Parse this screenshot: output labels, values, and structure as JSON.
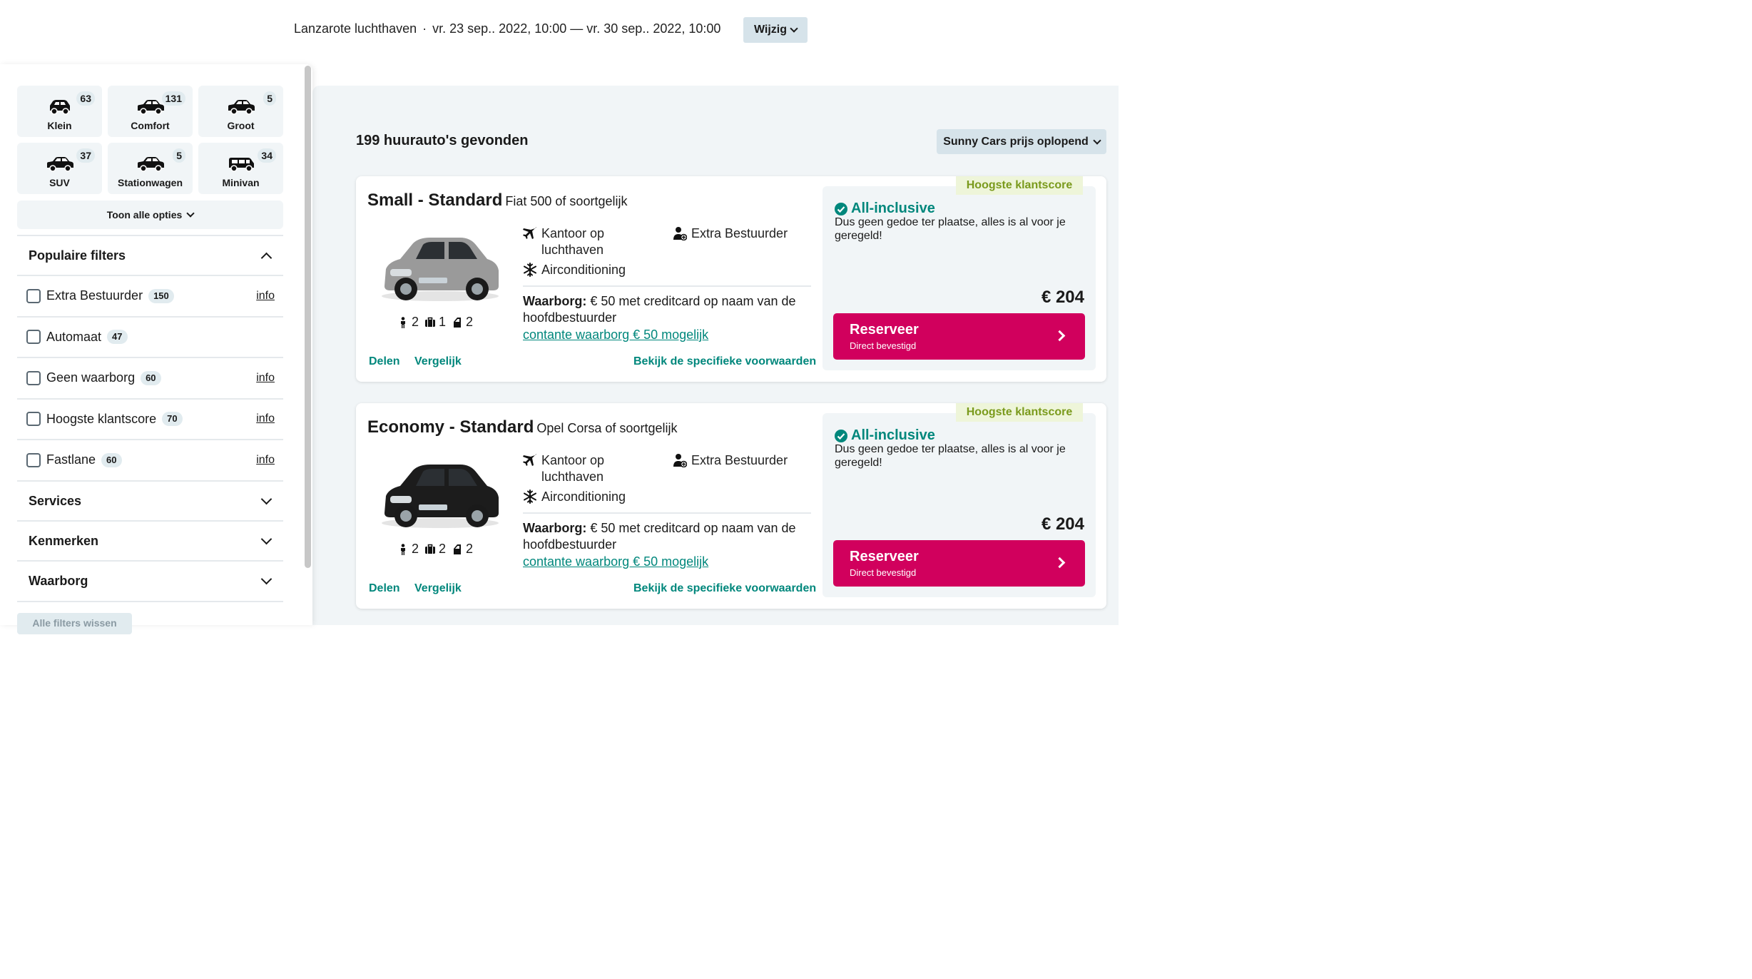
{
  "search": {
    "location": "Lanzarote luchthaven",
    "separator": "·",
    "dates": "vr. 23 sep.. 2022, 10:00 — vr. 30 sep.. 2022, 10:00",
    "change_label": "Wijzig"
  },
  "categories": [
    {
      "label": "Klein",
      "count": "63",
      "icon": "car-small-icon"
    },
    {
      "label": "Comfort",
      "count": "131",
      "icon": "car-comfort-icon"
    },
    {
      "label": "Groot",
      "count": "5",
      "icon": "car-large-icon"
    },
    {
      "label": "SUV",
      "count": "37",
      "icon": "suv-icon"
    },
    {
      "label": "Stationwagen",
      "count": "5",
      "icon": "station-wagon-icon"
    },
    {
      "label": "Minivan",
      "count": "34",
      "icon": "minivan-icon"
    }
  ],
  "show_all_label": "Toon alle opties",
  "popular_filters": {
    "title": "Populaire filters",
    "items": [
      {
        "label": "Extra Bestuurder",
        "count": "150",
        "info": "info"
      },
      {
        "label": "Automaat",
        "count": "47",
        "info": ""
      },
      {
        "label": "Geen waarborg",
        "count": "60",
        "info": "info"
      },
      {
        "label": "Hoogste klantscore",
        "count": "70",
        "info": "info"
      },
      {
        "label": "Fastlane",
        "count": "60",
        "info": "info"
      }
    ]
  },
  "sections": [
    "Services",
    "Kenmerken",
    "Waarborg"
  ],
  "clear_filters_label": "Alle filters wissen",
  "results": {
    "count_label": "199 huurauto's gevonden",
    "sort_label": "Sunny Cars prijs oplopend"
  },
  "cards": [
    {
      "category": "Small - Standard",
      "model": "Fiat 500 of soortgelijk",
      "car_color": "#9a9a9a",
      "passengers": "2",
      "suitcases": "1",
      "doors": "2",
      "feature_office": "Kantoor op luchthaven",
      "feature_ac": "Airconditioning",
      "feature_driver": "Extra Bestuurder",
      "deposit_label": "Waarborg:",
      "deposit_text": "€ 50 met creditcard op naam van de hoofdbestuurder",
      "deposit_link": "contante waarborg € 50 mogelijk",
      "share": "Delen",
      "compare": "Vergelijk",
      "terms": "Bekijk de specifieke voorwaarden",
      "badge": "Hoogste klantscore",
      "allinc_title": "All-inclusive",
      "allinc_desc": "Dus geen gedoe ter plaatse, alles is al voor je geregeld!",
      "price": "€ 204",
      "reserve_label": "Reserveer",
      "reserve_sub": "Direct bevestigd"
    },
    {
      "category": "Economy - Standard",
      "model": "Opel Corsa of soortgelijk",
      "car_color": "#1c1c1c",
      "passengers": "2",
      "suitcases": "2",
      "doors": "2",
      "feature_office": "Kantoor op luchthaven",
      "feature_ac": "Airconditioning",
      "feature_driver": "Extra Bestuurder",
      "deposit_label": "Waarborg:",
      "deposit_text": "€ 50 met creditcard op naam van de hoofdbestuurder",
      "deposit_link": "contante waarborg € 50 mogelijk",
      "share": "Delen",
      "compare": "Vergelijk",
      "terms": "Bekijk de specifieke voorwaarden",
      "badge": "Hoogste klantscore",
      "allinc_title": "All-inclusive",
      "allinc_desc": "Dus geen gedoe ter plaatse, alles is al voor je geregeld!",
      "price": "€ 204",
      "reserve_label": "Reserveer",
      "reserve_sub": "Direct bevestigd"
    }
  ],
  "colors": {
    "accent_teal": "#00877c",
    "reserve_pink": "#d1005d",
    "badge_bg": "#eef5d9",
    "badge_text": "#7a9a1c",
    "panel_bg": "#f1f5f7"
  }
}
